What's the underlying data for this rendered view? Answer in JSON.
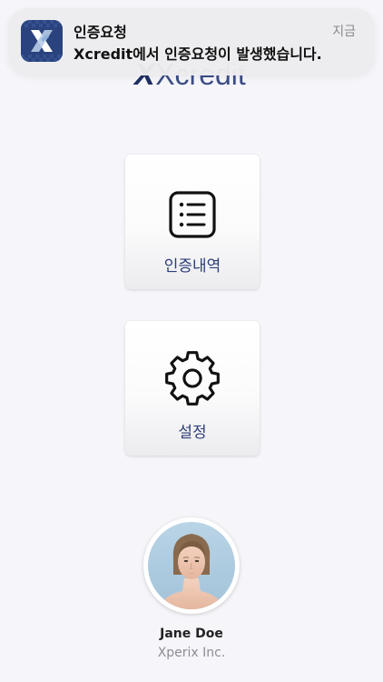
{
  "app": {
    "logo_text": "Xcredit",
    "brand_color": "#2c3e76"
  },
  "notification": {
    "icon": "xcredit-app-icon",
    "title": "인증요청",
    "body": "Xcredit에서 인증요청이 발생했습니다.",
    "time": "지금"
  },
  "menu": {
    "history": {
      "label": "인증내역",
      "icon": "list-icon"
    },
    "settings": {
      "label": "설정",
      "icon": "gear-icon"
    }
  },
  "profile": {
    "name": "Jane Doe",
    "company": "Xperix Inc."
  }
}
